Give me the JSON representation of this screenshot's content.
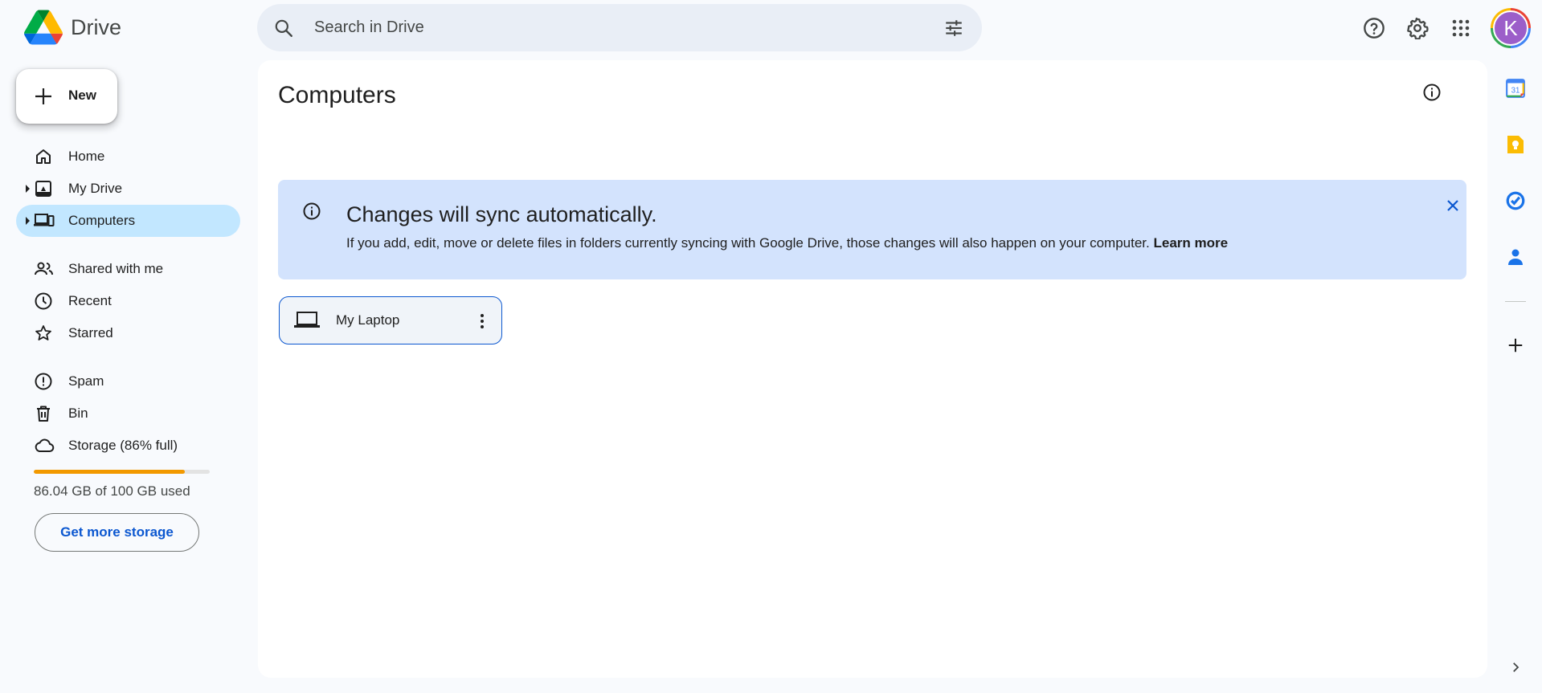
{
  "app": {
    "name": "Drive"
  },
  "search": {
    "placeholder": "Search in Drive"
  },
  "user": {
    "initial": "K"
  },
  "sidebar": {
    "new_label": "New",
    "items": [
      {
        "label": "Home"
      },
      {
        "label": "My Drive"
      },
      {
        "label": "Computers"
      },
      {
        "label": "Shared with me"
      },
      {
        "label": "Recent"
      },
      {
        "label": "Starred"
      },
      {
        "label": "Spam"
      },
      {
        "label": "Bin"
      },
      {
        "label": "Storage (86% full)"
      }
    ],
    "storage": {
      "used_text": "86.04 GB of 100 GB used",
      "fraction": 0.86,
      "button_label": "Get more storage"
    }
  },
  "main": {
    "title": "Computers",
    "banner": {
      "title": "Changes will sync automatically.",
      "text": "If you add, edit, move or delete files in folders currently syncing with Google Drive, those changes will also happen on your computer.",
      "link": "Learn more"
    },
    "computers": [
      {
        "name": "My Laptop"
      }
    ]
  },
  "side_panel": {
    "calendar_day": "31"
  },
  "colors": {
    "accent": "#0b57d0",
    "active_nav": "#c2e7ff",
    "banner": "#d3e3fd",
    "storage": "#f29900"
  }
}
